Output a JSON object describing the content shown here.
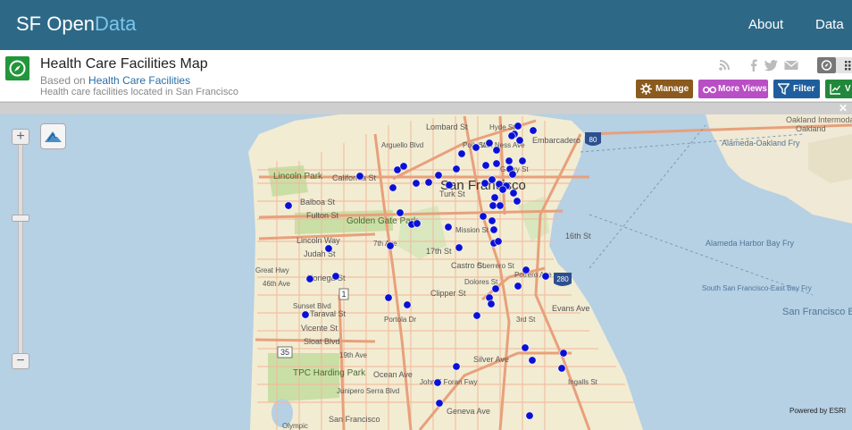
{
  "brand": {
    "prefix": "SF Open",
    "accent": "Data",
    "accent_color": "#7cc5ec",
    "bar_color": "#2d6987"
  },
  "nav": {
    "about": "About",
    "data": "Data"
  },
  "header": {
    "title": "Health Care Facilities Map",
    "based_prefix": "Based on ",
    "based_link": "Health Care Facilities",
    "description": "Health care facilities located in San Francisco"
  },
  "share_icons": [
    "rss-icon",
    "facebook-icon",
    "twitter-icon",
    "email-icon"
  ],
  "buttons": {
    "manage": {
      "label": "Manage",
      "color": "#8b5a1e"
    },
    "more_views": {
      "label": "More Views",
      "color": "#b94fc4"
    },
    "filter": {
      "label": "Filter",
      "color": "#1f5e9c"
    },
    "visualize": {
      "label": "V",
      "color": "#21883b"
    }
  },
  "map": {
    "attribution": "Powered by ESRI",
    "labels": [
      "Lombard St",
      "Embarcadero",
      "Lincoln Park",
      "California St",
      "San Francisco",
      "Balboa St",
      "Turk St",
      "Fulton St",
      "Golden Gate Park",
      "Lincoln Way",
      "Judah St",
      "Noriega St",
      "Taraval St",
      "Vicente St",
      "Sloat Blvd",
      "TPC Harding Park",
      "17th St",
      "Castro St",
      "Clipper St",
      "16th St",
      "Evans Ave",
      "Silver Ave",
      "Ocean Ave",
      "Geneva Ave",
      "Oakland Intermodal",
      "Alameda-Oakland Fry",
      "Alameda Harbor Bay Fry",
      "South San Francisco-East Bay Fry",
      "San Francisco Bay",
      "Great Hwy",
      "46th Ave",
      "Sunset Blvd",
      "19th Ave",
      "Arguello Blvd",
      "7th Ave",
      "Mission St",
      "Dolores St",
      "Guerrero St",
      "3rd St",
      "John F Foran Fwy",
      "Ingalls St",
      "Hyde St",
      "Van Ness Ave",
      "Polk St",
      "Portola Dr",
      "Geary St",
      "Potrero Ave",
      "San Francisco",
      "Junipero Serra Blvd",
      "Olympic",
      "Oakland",
      "1",
      "35",
      "80",
      "280"
    ],
    "facility_count": 64
  }
}
